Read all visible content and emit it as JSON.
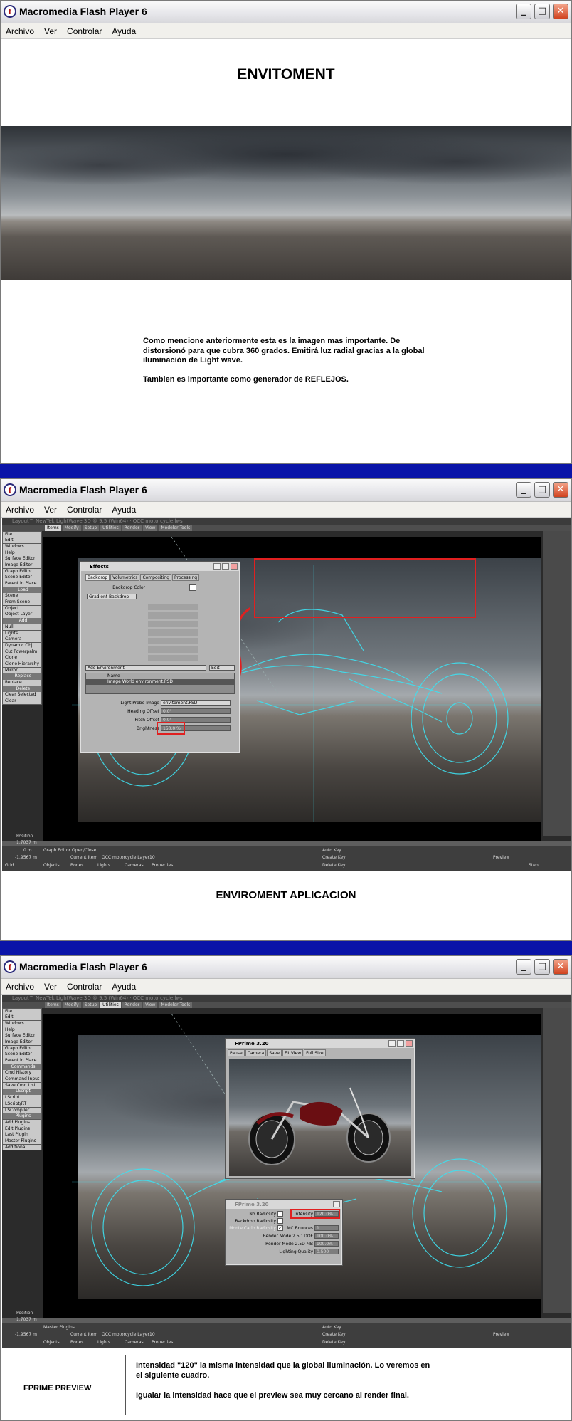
{
  "windows": [
    {
      "title": "Macromedia Flash Player 6",
      "menu": [
        "Archivo",
        "Ver",
        "Controlar",
        "Ayuda"
      ]
    },
    {
      "title": "Macromedia Flash Player 6",
      "menu": [
        "Archivo",
        "Ver",
        "Controlar",
        "Ayuda"
      ]
    },
    {
      "title": "Macromedia Flash Player 6",
      "menu": [
        "Archivo",
        "Ver",
        "Controlar",
        "Ayuda"
      ]
    }
  ],
  "slide1": {
    "heading": "ENVITOMENT",
    "caption_lines": [
      "Como mencione anteriormente esta es la imagen mas importante. De",
      "distorsionó para que cubra 360 grados. Emitirá luz radial gracias a la global",
      "iluminación de Light wave."
    ],
    "caption_extra": "Tambien es importante como generador de REFLEJOS."
  },
  "slide2": {
    "heading": "ENVIROMENT APLICACION",
    "lw_title": "Layout™ NewTek LightWave 3D ® 9.5 (Win64) · OCC motorcycle.lws",
    "tabs": [
      "Items",
      "Modify",
      "Setup",
      "Utilities",
      "Render",
      "View",
      "Modeler Tools"
    ],
    "sidebar": [
      "File",
      "Edit",
      "Windows",
      "Help",
      "Surface Editor",
      "Image Editor",
      "Graph Editor",
      "Scene Editor",
      "Parent in Place",
      "Load",
      "Scene",
      "From Scene",
      "Object",
      "Object Layer",
      "Add",
      "Null",
      "Lights",
      "Camera",
      "Dynamic Obj",
      "Cut Powerpalm",
      "Clone",
      "Clone Hierarchy",
      "Mirror",
      "Replace",
      "Replace",
      "Delete",
      "Clear Selected",
      "Clear"
    ],
    "effects": {
      "title": "Effects",
      "tabs": [
        "Backdrop",
        "Volumetrics",
        "Compositing",
        "Processing"
      ],
      "backdrop_color_label": "Backdrop Color",
      "gradient_button": "Gradient Backdrop",
      "add_environment": "Add Environment",
      "edit": "Edit",
      "list_header": "Name",
      "list_item": "Image World environment.PSD",
      "rows": [
        {
          "label": "Light Probe Image",
          "value": "envitoment.PSD"
        },
        {
          "label": "Heading Offset",
          "value": "0.0°"
        },
        {
          "label": "Pitch Offset",
          "value": "0.0°"
        },
        {
          "label": "Brightness",
          "value": "150.0 %"
        }
      ]
    },
    "bottom": {
      "position": "Position",
      "x": "1.7037 m",
      "y": "0 m",
      "z": "-1.9567 m",
      "grid": "Grid",
      "grid_val": "1 m",
      "auto_key": "Auto Key",
      "create_key": "Create Key",
      "delete_key": "Delete Key",
      "current_item_label": "Current Item",
      "current_item": "OCC motorcycle.Layer10",
      "graph_editor": "Graph Editor Open/Close",
      "sel": "Sel:",
      "objects": "Objects",
      "bones": "Bones",
      "lights": "Lights",
      "cameras": "Cameras",
      "properties": "Properties",
      "preview": "Preview",
      "step": "Step",
      "ticks": [
        "0",
        "10",
        "20",
        "30",
        "40",
        "50",
        "60"
      ]
    }
  },
  "slide3": {
    "fprime_title": "FPrime 3.20",
    "fprime_buttons": [
      "Pause",
      "Camera",
      "Save",
      "Fit View",
      "Full Size"
    ],
    "fprime_small_title": "FPrime 3.20",
    "settings": [
      {
        "label": "No Radiosity",
        "right_label": "Intensity",
        "right_value": "120.0%"
      },
      {
        "label": "Backdrop Radiosity",
        "right_label": "",
        "right_value": ""
      },
      {
        "label": "Monte Carlo Radiosity",
        "right_label": "MC Bounces",
        "right_value": "1"
      },
      {
        "label": "",
        "right_label": "Render Mode 2.5D DOF",
        "right_value": "100.0%"
      },
      {
        "label": "",
        "right_label": "Render Mode 2.5D MB",
        "right_value": "100.0%"
      },
      {
        "label": "",
        "right_label": "Lighting Quality",
        "right_value": "0.500"
      }
    ],
    "sidebar": [
      "File",
      "Edit",
      "Windows",
      "Help",
      "Surface Editor",
      "Image Editor",
      "Graph Editor",
      "Scene Editor",
      "Parent in Place",
      "Commands",
      "Cmd History",
      "Command Input",
      "Save Cmd List",
      "LScript",
      "LScript",
      "LScript/RT",
      "LSCompiler",
      "Plugins",
      "Add Plugins",
      "Edit Plugins",
      "Last Plugin",
      "Master Plugins",
      "Additional"
    ],
    "bottom_master": "Master Plugins",
    "footer_label": "FPRIME PREVIEW",
    "footer_lines": [
      "Intensidad \"120\" la misma intensidad que la global iluminación. Lo veremos en",
      "el siguiente cuadro."
    ],
    "footer_extra": "Igualar la intensidad  hace que el preview sea muy cercano al render final."
  },
  "colors": {
    "accent_blue": "#0a14a8",
    "wireframe_cyan": "#3ee0f0",
    "highlight_red": "#e02020"
  }
}
